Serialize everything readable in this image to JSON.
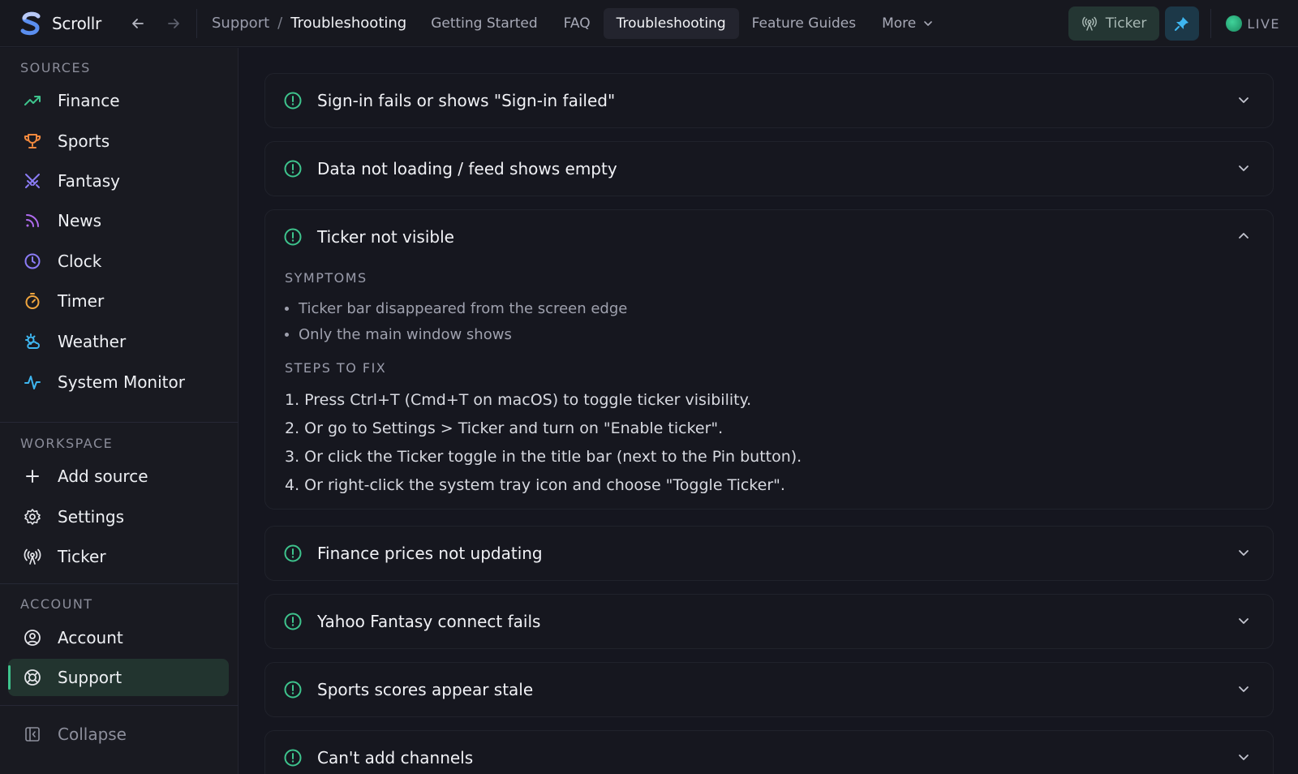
{
  "app": {
    "name": "Scrollr"
  },
  "breadcrumb": {
    "root": "Support",
    "separator": "/",
    "current": "Troubleshooting"
  },
  "tabs": [
    {
      "label": "Getting Started"
    },
    {
      "label": "FAQ"
    },
    {
      "label": "Troubleshooting",
      "active": true
    },
    {
      "label": "Feature Guides"
    },
    {
      "label": "More"
    }
  ],
  "toolbar": {
    "ticker_label": "Ticker",
    "live_label": "LIVE"
  },
  "sidebar": {
    "sources_title": "SOURCES",
    "sources": [
      {
        "label": "Finance",
        "icon": "trending-up-icon",
        "color": "#3ec48d"
      },
      {
        "label": "Sports",
        "icon": "trophy-icon",
        "color": "#f0883e"
      },
      {
        "label": "Fantasy",
        "icon": "swords-icon",
        "color": "#8b7cf6"
      },
      {
        "label": "News",
        "icon": "rss-icon",
        "color": "#b06cf0"
      },
      {
        "label": "Clock",
        "icon": "clock-icon",
        "color": "#8b7cf6"
      },
      {
        "label": "Timer",
        "icon": "timer-icon",
        "color": "#f0a53e"
      },
      {
        "label": "Weather",
        "icon": "weather-icon",
        "color": "#3eb6f0"
      },
      {
        "label": "System Monitor",
        "icon": "activity-icon",
        "color": "#3eb6f0"
      }
    ],
    "workspace_title": "WORKSPACE",
    "workspace": [
      {
        "label": "Add source",
        "icon": "plus-icon"
      },
      {
        "label": "Settings",
        "icon": "gear-icon"
      },
      {
        "label": "Ticker",
        "icon": "broadcast-icon"
      }
    ],
    "account_title": "ACCOUNT",
    "account": [
      {
        "label": "Account",
        "icon": "user-circle-icon"
      },
      {
        "label": "Support",
        "icon": "lifebuoy-icon",
        "active": true
      }
    ],
    "collapse_label": "Collapse"
  },
  "troubleshooting": {
    "items": [
      {
        "question": "Sign-in fails or shows \"Sign-in failed\"",
        "expanded": false
      },
      {
        "question": "Data not loading / feed shows empty",
        "expanded": false
      },
      {
        "question": "Ticker not visible",
        "expanded": true
      },
      {
        "question": "Finance prices not updating",
        "expanded": false
      },
      {
        "question": "Yahoo Fantasy connect fails",
        "expanded": false
      },
      {
        "question": "Sports scores appear stale",
        "expanded": false
      },
      {
        "question": "Can't add channels",
        "expanded": false
      }
    ],
    "expanded": {
      "symptoms_title": "SYMPTOMS",
      "symptoms": [
        "Ticker bar disappeared from the screen edge",
        "Only the main window shows"
      ],
      "steps_title": "STEPS TO FIX",
      "steps": [
        "1. Press Ctrl+T (Cmd+T on macOS) to toggle ticker visibility.",
        "2. Or go to Settings > Ticker and turn on \"Enable ticker\".",
        "3. Or click the Ticker toggle in the title bar (next to the Pin button).",
        "4. Or right-click the system tray icon and choose \"Toggle Ticker\"."
      ]
    }
  },
  "colors": {
    "accent": "#3ec48d",
    "background": "#15161f",
    "sidebar": "#191a21"
  }
}
